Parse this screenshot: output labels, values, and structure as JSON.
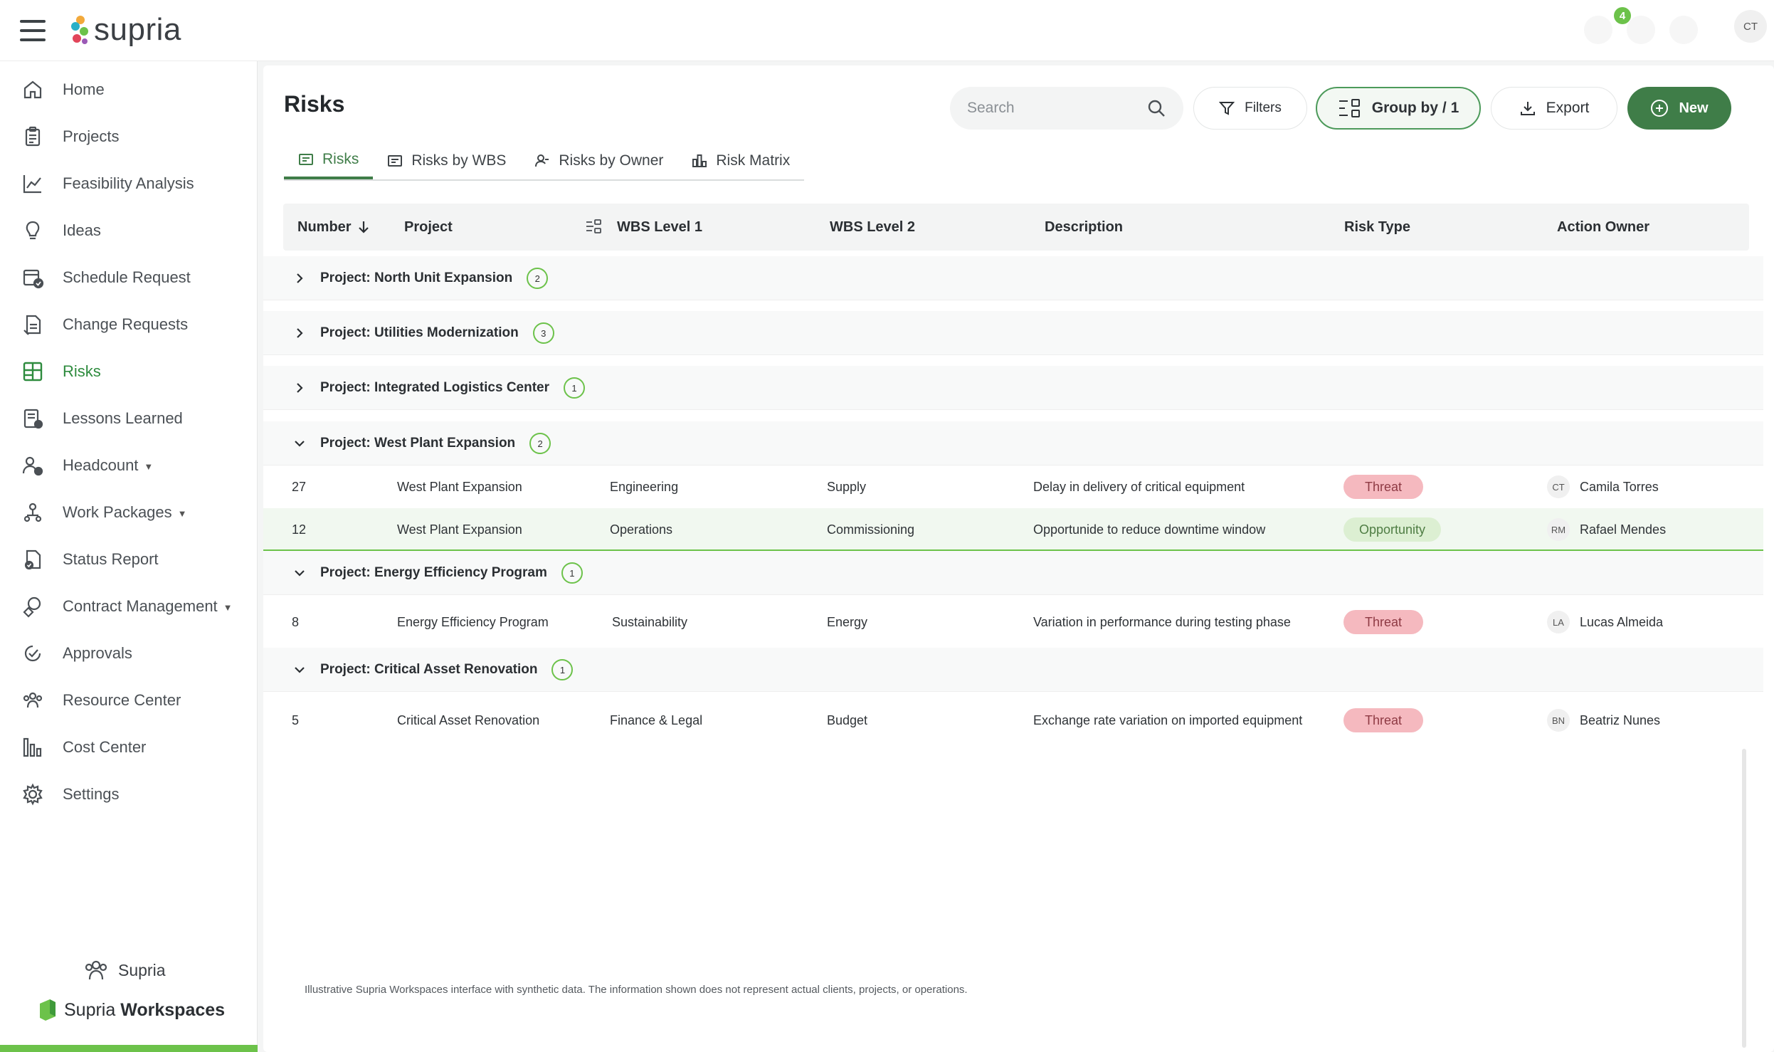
{
  "app": {
    "name": "supria",
    "notification_count": "4",
    "user_initials": "CT"
  },
  "sidebar": {
    "items": [
      {
        "label": "Home",
        "icon": "home-icon"
      },
      {
        "label": "Projects",
        "icon": "clipboard-icon"
      },
      {
        "label": "Feasibility Analysis",
        "icon": "chart-line-icon"
      },
      {
        "label": "Ideas",
        "icon": "lightbulb-icon"
      },
      {
        "label": "Schedule Request",
        "icon": "calendar-check-icon"
      },
      {
        "label": "Change Requests",
        "icon": "document-edit-icon"
      },
      {
        "label": "Risks",
        "icon": "grid-icon",
        "active": true
      },
      {
        "label": "Lessons Learned",
        "icon": "book-icon"
      },
      {
        "label": "Headcount",
        "icon": "people-icon",
        "dropdown": true
      },
      {
        "label": "Work Packages",
        "icon": "person-structure-icon",
        "dropdown": true
      },
      {
        "label": "Status Report",
        "icon": "report-icon"
      },
      {
        "label": "Contract Management",
        "icon": "handshake-icon",
        "dropdown": true
      },
      {
        "label": "Approvals",
        "icon": "approval-icon"
      },
      {
        "label": "Resource Center",
        "icon": "team-icon"
      },
      {
        "label": "Cost Center",
        "icon": "bar-chart-icon"
      },
      {
        "label": "Settings",
        "icon": "gear-icon"
      }
    ],
    "footer_org": "Supria",
    "footer_brand_prefix": "Supria",
    "footer_brand_bold": "Workspaces"
  },
  "page": {
    "title": "Risks"
  },
  "toolbar": {
    "search_placeholder": "Search",
    "filters_label": "Filters",
    "group_by_label": "Group by / 1",
    "export_label": "Export",
    "new_label": "New"
  },
  "tabs": [
    {
      "label": "Risks",
      "active": true
    },
    {
      "label": "Risks by WBS"
    },
    {
      "label": "Risks by Owner"
    },
    {
      "label": "Risk Matrix"
    }
  ],
  "table": {
    "columns": [
      "Number",
      "Project",
      "WBS Level 1",
      "WBS Level 2",
      "Description",
      "Risk Type",
      "Action Owner"
    ],
    "groups": [
      {
        "title": "Project: North Unit Expansion",
        "count": "2",
        "expanded": false,
        "rows": []
      },
      {
        "title": "Project: Utilities Modernization",
        "count": "3",
        "expanded": false,
        "rows": []
      },
      {
        "title": "Project: Integrated Logistics Center",
        "count": "1",
        "expanded": false,
        "rows": []
      },
      {
        "title": "Project: West Plant Expansion",
        "count": "2",
        "expanded": true,
        "rows": [
          {
            "number": "27",
            "project": "West Plant Expansion",
            "wbs1": "Engineering",
            "wbs2": "Supply",
            "description": "Delay in delivery of critical equipment",
            "risk_type": "Threat",
            "owner_initials": "CT",
            "owner": "Camila Torres"
          },
          {
            "number": "12",
            "project": "West Plant Expansion",
            "wbs1": "Operations",
            "wbs2": "Commissioning",
            "description": "Opportunide to reduce downtime window",
            "risk_type": "Opportunity",
            "owner_initials": "RM",
            "owner": "Rafael Mendes"
          }
        ]
      },
      {
        "title": "Project: Energy Efficiency Program",
        "count": "1",
        "expanded": true,
        "rows": [
          {
            "number": "8",
            "project": "Energy Efficiency Program",
            "wbs1": "Sustainability",
            "wbs2": "Energy",
            "description": "Variation in performance during testing phase",
            "risk_type": "Threat",
            "owner_initials": "LA",
            "owner": "Lucas Almeida"
          }
        ]
      },
      {
        "title": "Project: Critical Asset Renovation",
        "count": "1",
        "expanded": true,
        "rows": [
          {
            "number": "5",
            "project": "Critical Asset Renovation",
            "wbs1": "Finance & Legal",
            "wbs2": "Budget",
            "description": "Exchange rate variation on imported equipment",
            "risk_type": "Threat",
            "owner_initials": "BN",
            "owner": "Beatriz Nunes"
          }
        ]
      }
    ]
  },
  "footer": {
    "disclaimer": "Illustrative Supria Workspaces interface with synthetic data. The information shown does not represent actual clients, projects, or operations."
  },
  "colors": {
    "accent_green": "#3f7d48",
    "bright_green": "#6cc24a",
    "threat_pill": "#f5b9bf",
    "opportunity_pill": "#dcefd2"
  }
}
